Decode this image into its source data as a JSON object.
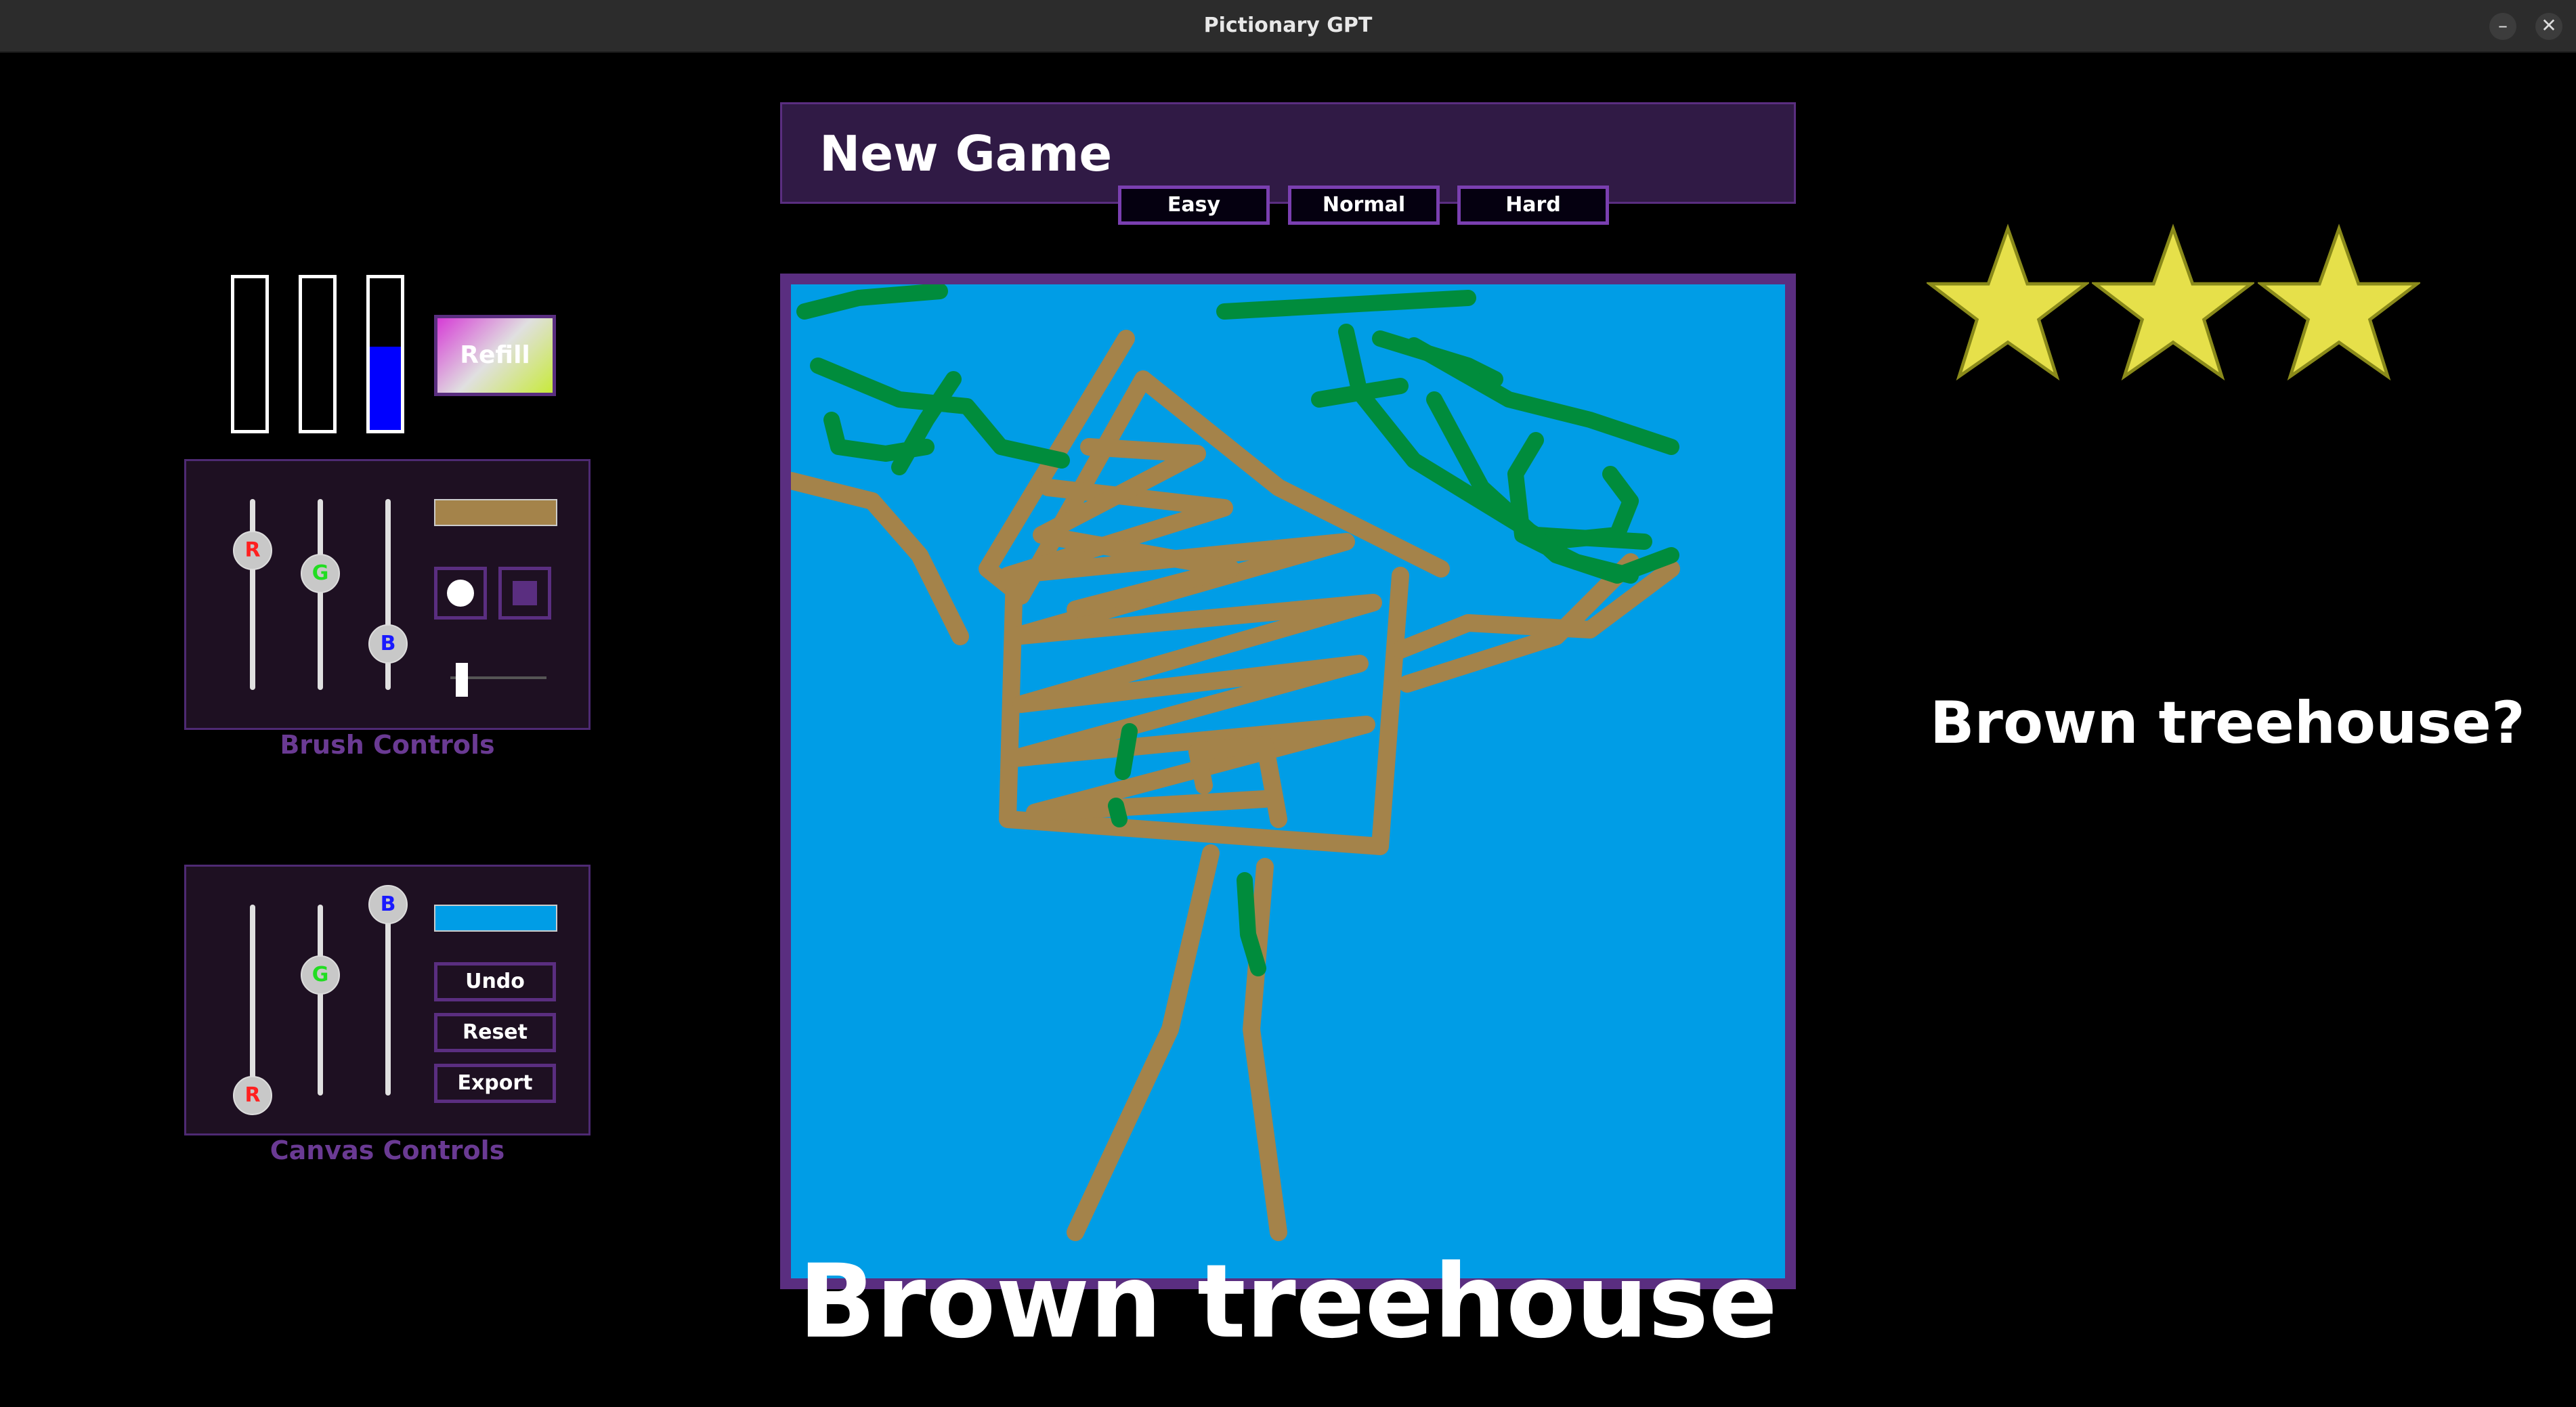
{
  "window": {
    "title": "Pictionary GPT",
    "minimize_glyph": "–",
    "close_glyph": "✕"
  },
  "header": {
    "title": "New Game",
    "difficulty_buttons": [
      "Easy",
      "Normal",
      "Hard"
    ]
  },
  "paint_tubes": [
    {
      "color": "#ff0000",
      "level": 0
    },
    {
      "color": "#00c000",
      "level": 0
    },
    {
      "color": "#0000ff",
      "level": 0.55
    }
  ],
  "refill_label": "Refill",
  "brush_controls": {
    "label": "Brush Controls",
    "sliders": [
      {
        "name": "R",
        "color": "#ff2020",
        "value": 0.73
      },
      {
        "name": "G",
        "color": "#22dd22",
        "value": 0.61
      },
      {
        "name": "B",
        "color": "#1a1aff",
        "value": 0.24
      }
    ],
    "color": "#a4834a",
    "tools": [
      "round-brush-icon",
      "square-brush-icon"
    ],
    "size_value": 0.12
  },
  "canvas_controls": {
    "label": "Canvas Controls",
    "sliders": [
      {
        "name": "R",
        "color": "#ff2020",
        "value": 0.0
      },
      {
        "name": "G",
        "color": "#22dd22",
        "value": 0.63
      },
      {
        "name": "B",
        "color": "#1a1aff",
        "value": 1.0
      }
    ],
    "color": "#009de6",
    "buttons": [
      "Undo",
      "Reset",
      "Export"
    ]
  },
  "canvas_background": "#009de6",
  "stroke_colors": {
    "brown": "#a4834a",
    "green": "#008c3c"
  },
  "stars": {
    "earned": 3,
    "total": 3,
    "color": "#e6e04a"
  },
  "guess": "Brown treehouse?",
  "prompt_word": "Brown treehouse"
}
